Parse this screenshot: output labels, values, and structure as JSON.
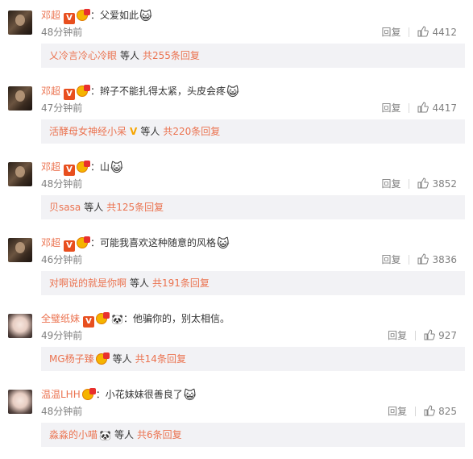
{
  "comments": [
    {
      "avatar": "dark",
      "name": "邓超",
      "badge": "V",
      "text": "父爱如此",
      "emoji": "😺",
      "time": "48分钟前",
      "reply_label": "回复",
      "likes": "4412",
      "replies": {
        "from": "乂冷言冷心冷眼",
        "who": "等人",
        "count": "共255条回复"
      }
    },
    {
      "avatar": "dark",
      "name": "邓超",
      "badge": "V",
      "text": "辫子不能扎得太紧，头皮会疼",
      "emoji": "😺",
      "time": "47分钟前",
      "reply_label": "回复",
      "likes": "4417",
      "replies": {
        "from": "活酵母女神经小呆",
        "vip": "V",
        "who": "等人",
        "count": "共220条回复"
      }
    },
    {
      "avatar": "dark",
      "name": "邓超",
      "badge": "V",
      "text": "山",
      "emoji": "😺",
      "time": "48分钟前",
      "reply_label": "回复",
      "likes": "3852",
      "replies": {
        "from": "贝sasa",
        "who": "等人",
        "count": "共125条回复"
      }
    },
    {
      "avatar": "dark",
      "name": "邓超",
      "badge": "V",
      "text": "可能我喜欢这种随意的风格",
      "emoji": "😺",
      "time": "46分钟前",
      "reply_label": "回复",
      "likes": "3836",
      "replies": {
        "from": "对啊说的就是你啊",
        "who": "等人",
        "count": "共191条回复"
      }
    },
    {
      "avatar": "light",
      "name": "全璧纸妹",
      "badge": "V",
      "panda": "🐼",
      "text": "他骗你的，别太相信。",
      "emoji": "",
      "time": "49分钟前",
      "reply_label": "回复",
      "likes": "927",
      "replies": {
        "from": "MG杨子臻",
        "medal": true,
        "who": "等人",
        "count": "共14条回复"
      }
    },
    {
      "avatar": "light",
      "name": "温温LHH",
      "badge": "",
      "text": "小花妹妹很善良了",
      "emoji": "😺",
      "time": "48分钟前",
      "reply_label": "回复",
      "likes": "825",
      "replies": {
        "from": "淼淼的小喵",
        "panda": "🐼",
        "who": "等人",
        "count": "共6条回复"
      }
    }
  ],
  "colors": {
    "name": "#eb7350",
    "meta": "#808080",
    "reply_bg": "#f2f2f5",
    "badge": "#e84f1f"
  }
}
